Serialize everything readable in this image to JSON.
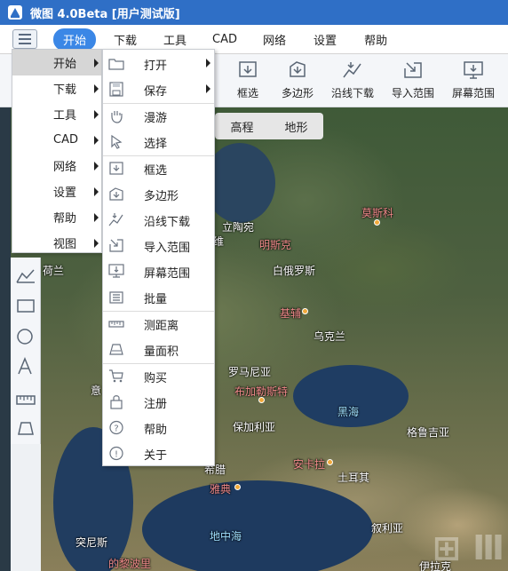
{
  "app": {
    "title": "微图 4.0Beta [用户测试版]"
  },
  "menubar": {
    "tabs": [
      {
        "label": "开始",
        "active": true
      },
      {
        "label": "下载"
      },
      {
        "label": "工具"
      },
      {
        "label": "CAD"
      },
      {
        "label": "网络"
      },
      {
        "label": "设置"
      },
      {
        "label": "帮助"
      }
    ]
  },
  "toolbar": {
    "tools": [
      {
        "label": "框选",
        "icon": "box-select-icon"
      },
      {
        "label": "多边形",
        "icon": "polygon-download-icon"
      },
      {
        "label": "沿线下载",
        "icon": "polyline-download-icon"
      },
      {
        "label": "导入范围",
        "icon": "import-range-icon"
      },
      {
        "label": "屏幕范围",
        "icon": "screen-range-icon"
      }
    ]
  },
  "map_switch": {
    "elevation": "高程",
    "terrain": "地形"
  },
  "main_menu": {
    "items": [
      {
        "label": "开始",
        "highlighted": true
      },
      {
        "label": "下载"
      },
      {
        "label": "工具"
      },
      {
        "label": "CAD"
      },
      {
        "label": "网络"
      },
      {
        "label": "设置"
      },
      {
        "label": "帮助"
      },
      {
        "label": "视图"
      }
    ]
  },
  "submenu": {
    "items": [
      {
        "label": "打开",
        "icon": "folder-open-icon",
        "has_sub": true
      },
      {
        "label": "保存",
        "icon": "save-icon",
        "has_sub": true
      },
      {
        "label": "漫游",
        "icon": "hand-pan-icon"
      },
      {
        "label": "选择",
        "icon": "cursor-select-icon"
      },
      {
        "label": "框选",
        "icon": "box-select-icon"
      },
      {
        "label": "多边形",
        "icon": "polygon-download-icon"
      },
      {
        "label": "沿线下载",
        "icon": "polyline-download-icon"
      },
      {
        "label": "导入范围",
        "icon": "import-range-icon"
      },
      {
        "label": "屏幕范围",
        "icon": "screen-range-icon"
      },
      {
        "label": "批量",
        "icon": "batch-icon"
      },
      {
        "label": "测距离",
        "icon": "measure-distance-icon"
      },
      {
        "label": "量面积",
        "icon": "measure-area-icon"
      },
      {
        "label": "购买",
        "icon": "cart-icon"
      },
      {
        "label": "注册",
        "icon": "lock-icon"
      },
      {
        "label": "帮助",
        "icon": "help-icon"
      },
      {
        "label": "关于",
        "icon": "info-icon"
      }
    ]
  },
  "map_labels": {
    "moscow": "莫斯科",
    "lithuania": "立陶宛",
    "minsk": "明斯克",
    "belarus": "白俄罗斯",
    "netherlands": "荷兰",
    "kyiv": "基辅",
    "ukraine": "乌克兰",
    "romania": "罗马尼亚",
    "bucharest": "布加勒斯特",
    "black_sea": "黑海",
    "georgia": "格鲁吉亚",
    "bulgaria": "保加利亚",
    "greece": "希腊",
    "athens": "雅典",
    "ankara": "安卡拉",
    "turkey": "土耳其",
    "mediterranean": "地中海",
    "tunisia": "突尼斯",
    "tripoli": "的黎波里",
    "syria": "叙利亚",
    "italy": "意",
    "iraq": "伊拉克",
    "wei": "维"
  },
  "colors": {
    "titlebar": "#2f6fc6",
    "active_tab": "#3b87e6",
    "menu_highlight": "#d6d6d6"
  }
}
